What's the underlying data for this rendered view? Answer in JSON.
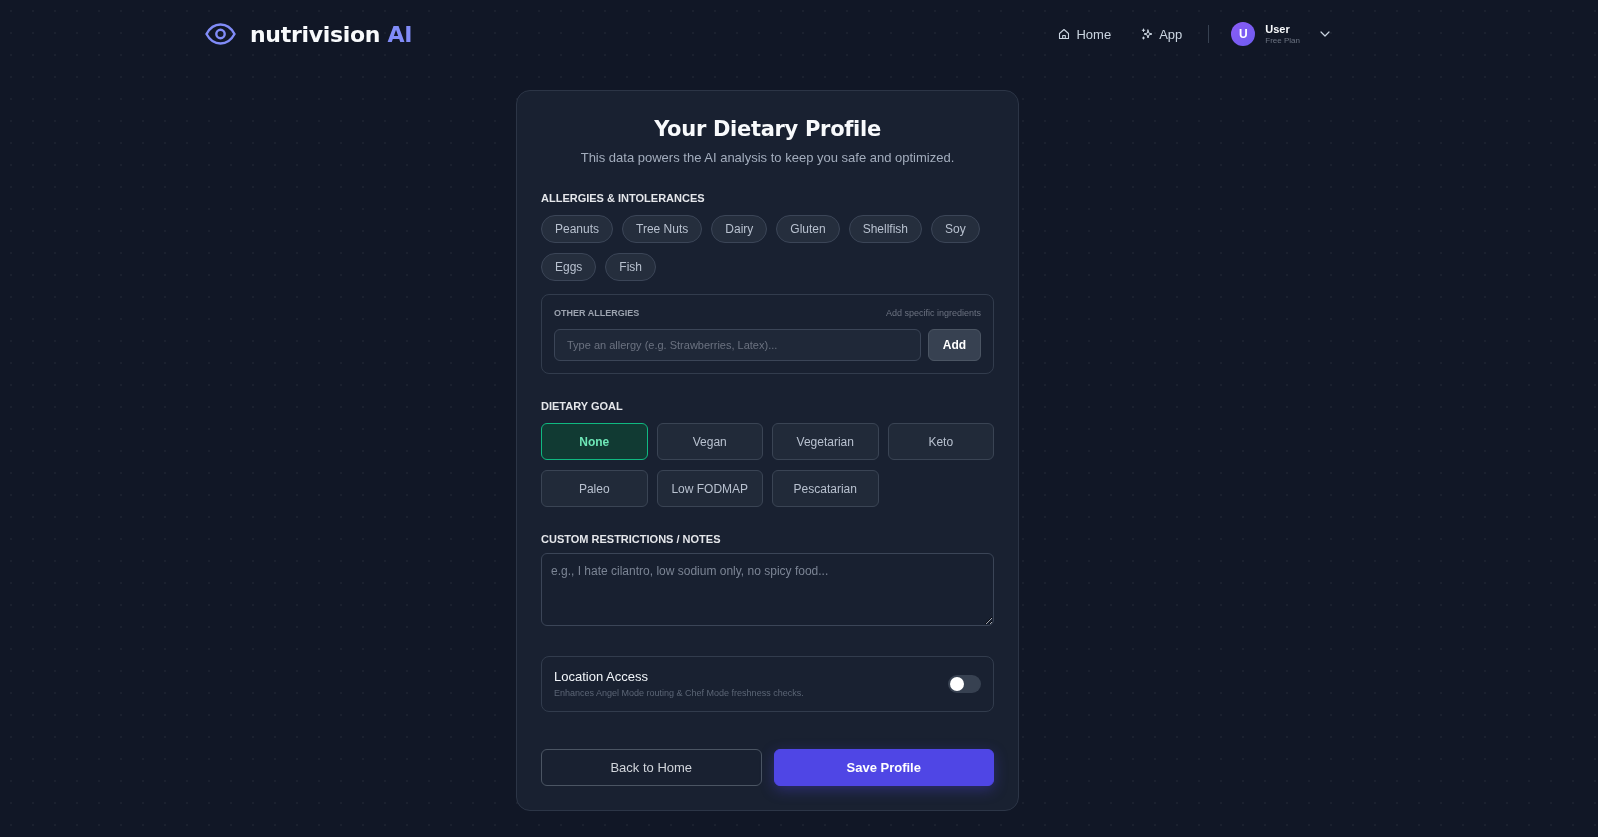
{
  "header": {
    "logo": {
      "name": "nutrivision",
      "accent": "AI"
    },
    "nav": [
      {
        "label": "Home"
      },
      {
        "label": "App"
      }
    ],
    "user": {
      "initial": "U",
      "name": "User",
      "plan": "Free Plan"
    }
  },
  "profile": {
    "title": "Your Dietary Profile",
    "subtitle": "This data powers the AI analysis to keep you safe and optimized.",
    "allergies": {
      "heading": "ALLERGIES & INTOLERANCES",
      "options": [
        {
          "label": "Peanuts",
          "selected": false
        },
        {
          "label": "Tree Nuts",
          "selected": false
        },
        {
          "label": "Dairy",
          "selected": false
        },
        {
          "label": "Gluten",
          "selected": false
        },
        {
          "label": "Shellfish",
          "selected": false
        },
        {
          "label": "Soy",
          "selected": false
        },
        {
          "label": "Eggs",
          "selected": false
        },
        {
          "label": "Fish",
          "selected": false
        }
      ]
    },
    "other_allergies": {
      "heading": "OTHER ALLERGIES",
      "hint": "Add specific ingredients",
      "input": {
        "placeholder": "Type an allergy (e.g. Strawberries, Latex)..."
      },
      "add_button": "Add"
    },
    "dietary_goal": {
      "heading": "DIETARY GOAL",
      "options": [
        {
          "label": "None",
          "selected": true
        },
        {
          "label": "Vegan",
          "selected": false
        },
        {
          "label": "Vegetarian",
          "selected": false
        },
        {
          "label": "Keto",
          "selected": false
        },
        {
          "label": "Paleo",
          "selected": false
        },
        {
          "label": "Low FODMAP",
          "selected": false
        },
        {
          "label": "Pescatarian",
          "selected": false
        }
      ]
    },
    "custom_notes": {
      "heading": "CUSTOM RESTRICTIONS / NOTES",
      "placeholder": "e.g., I hate cilantro, low sodium only, no spicy food..."
    },
    "location": {
      "title": "Location Access",
      "description": "Enhances Angel Mode routing & Chef Mode freshness checks.",
      "on": false
    },
    "buttons": [
      {
        "label": "Back to Home",
        "kind": "secondary"
      },
      {
        "label": "Save Profile",
        "kind": "primary"
      }
    ]
  }
}
